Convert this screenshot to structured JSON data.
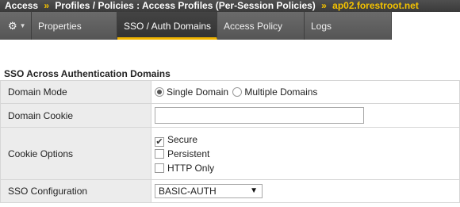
{
  "breadcrumb": {
    "parts": [
      "Access",
      "Profiles / Policies : Access Profiles (Per-Session Policies)"
    ],
    "separator": "»",
    "host": "ap02.forestroot.net"
  },
  "tabs": {
    "gear_icon": "⚙",
    "caret_icon": "▼",
    "items": [
      {
        "label": "Properties"
      },
      {
        "label": "SSO / Auth Domains"
      },
      {
        "label": "Access Policy"
      },
      {
        "label": "Logs"
      }
    ],
    "active": "SSO / Auth Domains"
  },
  "section": {
    "title": "SSO Across Authentication Domains"
  },
  "form": {
    "domain_mode": {
      "label": "Domain Mode",
      "options": [
        {
          "label": "Single Domain",
          "selected": true
        },
        {
          "label": "Multiple Domains",
          "selected": false
        }
      ]
    },
    "domain_cookie": {
      "label": "Domain Cookie",
      "value": ""
    },
    "cookie_options": {
      "label": "Cookie Options",
      "options": [
        {
          "label": "Secure",
          "checked": true,
          "mark": "✔"
        },
        {
          "label": "Persistent",
          "checked": false,
          "mark": ""
        },
        {
          "label": "HTTP Only",
          "checked": false,
          "mark": ""
        }
      ]
    },
    "sso_configuration": {
      "label": "SSO Configuration",
      "selected": "BASIC-AUTH",
      "arrow": "▼"
    }
  },
  "colors": {
    "accent": "#f0b400",
    "header_bg": "#3a3a3a",
    "tab_bg": "#5a5a5a"
  }
}
